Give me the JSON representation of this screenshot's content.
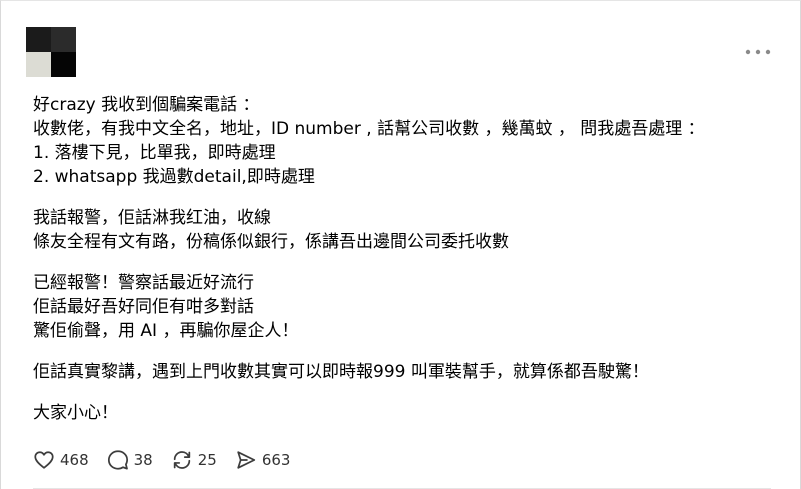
{
  "post": {
    "paragraphs": [
      {
        "lines": [
          "好crazy 我收到個騙案電話 ：",
          "收數佬，有我中文全名，地址，ID number , 話幫公司收數 ，幾萬蚊 ， 問我處吾處理 ：",
          "1. 落樓下見，比單我，即時處理",
          "2. whatsapp 我過數detail,即時處理"
        ]
      },
      {
        "lines": [
          "我話報警，佢話淋我红油，收線",
          "條友全程有文有路，份稿係似銀行，係講吾出邊間公司委托收數"
        ]
      },
      {
        "lines": [
          "已經報警！警察話最近好流行",
          "佢話最好吾好同佢有咁多對話",
          "驚佢偷聲，用 AI ，再騙你屋企人！"
        ]
      },
      {
        "lines": [
          "佢話真實黎講，遇到上門收數其實可以即時報999 叫軍裝幫手，就算係都吾駛驚！"
        ]
      },
      {
        "lines": [
          "大家小心！"
        ]
      }
    ]
  },
  "actions": {
    "like": {
      "icon": "heart-icon",
      "count": "468"
    },
    "reply": {
      "icon": "comment-icon",
      "count": "38"
    },
    "repost": {
      "icon": "repost-icon",
      "count": "25"
    },
    "share": {
      "icon": "send-icon",
      "count": "663"
    }
  },
  "more_menu": {
    "icon": "more-horizontal-icon"
  },
  "avatar_colors": [
    "#1b1b1b",
    "#2b2b2b",
    "#dcdcd4",
    "#050505"
  ],
  "icon_color": "#3d3d3d"
}
